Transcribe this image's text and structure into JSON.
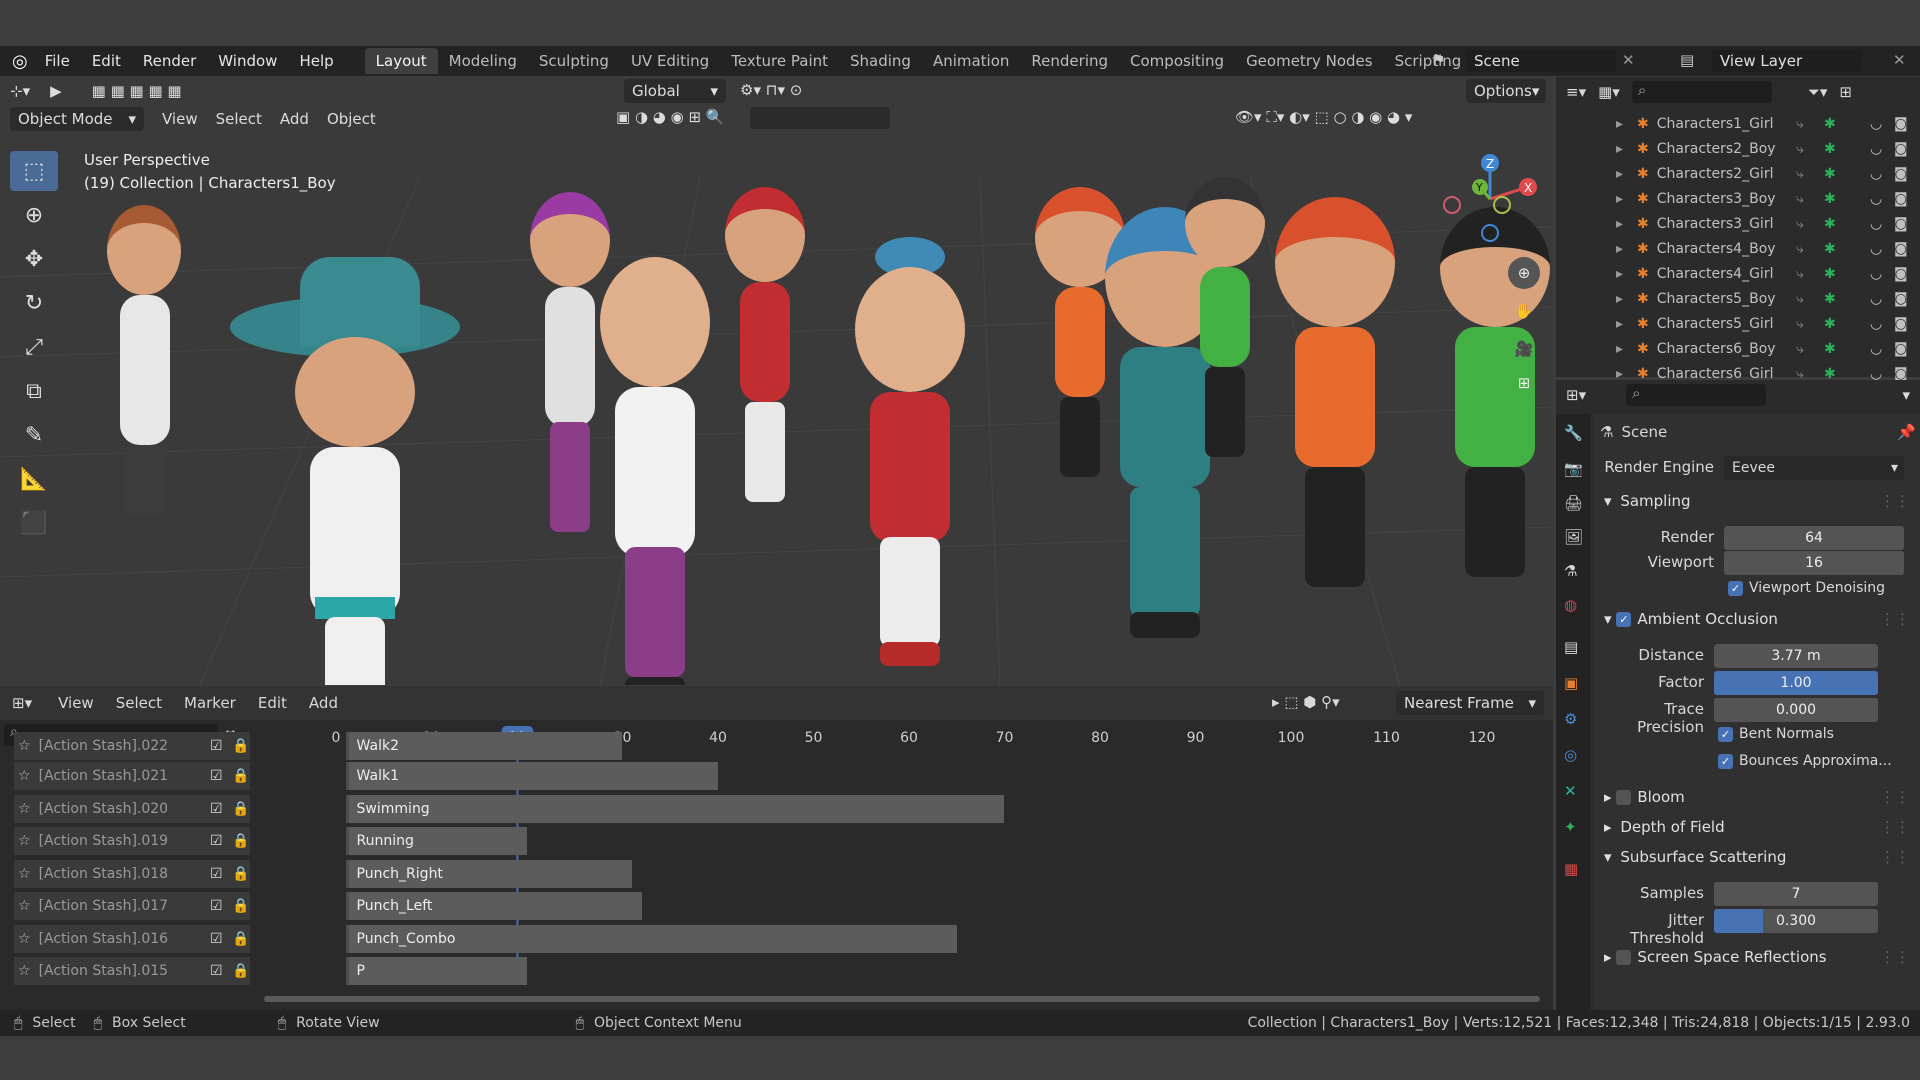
{
  "menu": [
    "File",
    "Edit",
    "Render",
    "Window",
    "Help"
  ],
  "workspace_tabs": [
    "Layout",
    "Modeling",
    "Sculpting",
    "UV Editing",
    "Texture Paint",
    "Shading",
    "Animation",
    "Rendering",
    "Compositing",
    "Geometry Nodes",
    "Scripting"
  ],
  "scene_name": "Scene",
  "view_layer": "View Layer",
  "viewport": {
    "mode": "Object Mode",
    "menu": [
      "View",
      "Select",
      "Add",
      "Object"
    ],
    "transform": "Global",
    "options": "Options",
    "overlay_title": "User Perspective",
    "overlay_sub": "(19) Collection | Characters1_Boy",
    "gizmo_axes": [
      "X",
      "Y",
      "Z"
    ]
  },
  "timeline": {
    "menu": [
      "View",
      "Select",
      "Marker",
      "Edit",
      "Add"
    ],
    "snap": "Nearest Frame",
    "current_frame": "19",
    "ticks": [
      "0",
      "10",
      "20",
      "30",
      "40",
      "50",
      "60",
      "70",
      "80",
      "90",
      "100",
      "110",
      "120"
    ],
    "tracks": [
      {
        "name": "[Action Stash].022",
        "strip": "Walk2",
        "end": 30
      },
      {
        "name": "[Action Stash].021",
        "strip": "Walk1",
        "end": 40
      },
      {
        "name": "[Action Stash].020",
        "strip": "Swimming",
        "end": 70
      },
      {
        "name": "[Action Stash].019",
        "strip": "Running",
        "end": 20
      },
      {
        "name": "[Action Stash].018",
        "strip": "Punch_Right",
        "end": 31
      },
      {
        "name": "[Action Stash].017",
        "strip": "Punch_Left",
        "end": 32
      },
      {
        "name": "[Action Stash].016",
        "strip": "Punch_Combo",
        "end": 65
      },
      {
        "name": "[Action Stash].015",
        "strip": "P",
        "end": 20
      }
    ]
  },
  "outliner": {
    "items": [
      "Characters1_Girl",
      "Characters2_Boy",
      "Characters2_Girl",
      "Characters3_Boy",
      "Characters3_Girl",
      "Characters4_Boy",
      "Characters4_Girl",
      "Characters5_Boy",
      "Characters5_Girl",
      "Characters6_Boy",
      "Characters6_Girl"
    ]
  },
  "properties": {
    "title": "Scene",
    "render_engine_label": "Render Engine",
    "render_engine": "Eevee",
    "sampling": "Sampling",
    "render_label": "Render",
    "render_value": "64",
    "viewport_label": "Viewport",
    "viewport_value": "16",
    "viewport_denoising": "Viewport Denoising",
    "ao": "Ambient Occlusion",
    "distance_label": "Distance",
    "distance_value": "3.77 m",
    "factor_label": "Factor",
    "factor_value": "1.00",
    "trace_label": "Trace Precision",
    "trace_value": "0.000",
    "bent_normals": "Bent Normals",
    "bounces": "Bounces Approxima...",
    "bloom": "Bloom",
    "dof": "Depth of Field",
    "sss": "Subsurface Scattering",
    "samples_label": "Samples",
    "samples_value": "7",
    "jitter_label": "Jitter Threshold",
    "jitter_value": "0.300",
    "jitter_fraction": 0.3,
    "ssr": "Screen Space Reflections"
  },
  "status": {
    "select": "Select",
    "box_select": "Box Select",
    "rotate": "Rotate View",
    "context": "Object Context Menu",
    "info": "Collection | Characters1_Boy | Verts:12,521 | Faces:12,348 | Tris:24,818 | Objects:1/15 | 2.93.0"
  },
  "colors": {
    "accent": "#4772b3",
    "active_tab": "#3f3f3f",
    "header": "#232323"
  }
}
